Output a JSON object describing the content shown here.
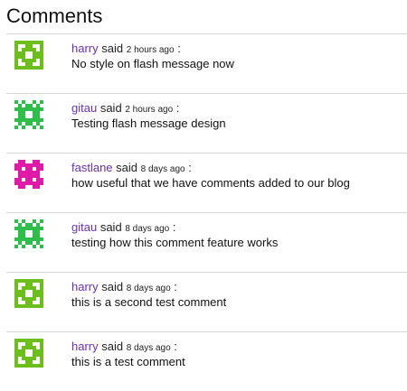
{
  "section": {
    "title": "Comments"
  },
  "comments": [
    {
      "author": "harry",
      "said": "said",
      "time": "2 hours ago",
      "colon": ":",
      "text": "No style on flash message now",
      "avatar": {
        "icon": "identicon-harry",
        "color": "#6cbf1a"
      }
    },
    {
      "author": "gitau",
      "said": "said",
      "time": "2 hours ago",
      "colon": ":",
      "text": "Testing flash message design",
      "avatar": {
        "icon": "identicon-gitau",
        "color": "#2ebf4a"
      }
    },
    {
      "author": "fastlane",
      "said": "said",
      "time": "8 days ago",
      "colon": ":",
      "text": "how useful that we have comments added to our blog",
      "avatar": {
        "icon": "identicon-fastlane",
        "color": "#e01aa8"
      }
    },
    {
      "author": "gitau",
      "said": "said",
      "time": "8 days ago",
      "colon": ":",
      "text": "testing how this comment feature works",
      "avatar": {
        "icon": "identicon-gitau",
        "color": "#2ebf4a"
      }
    },
    {
      "author": "harry",
      "said": "said",
      "time": "8 days ago",
      "colon": ":",
      "text": "this is a second test comment",
      "avatar": {
        "icon": "identicon-harry",
        "color": "#6cbf1a"
      }
    },
    {
      "author": "harry",
      "said": "said",
      "time": "8 days ago",
      "colon": ":",
      "text": "this is a test comment",
      "avatar": {
        "icon": "identicon-harry",
        "color": "#6cbf1a"
      }
    }
  ]
}
